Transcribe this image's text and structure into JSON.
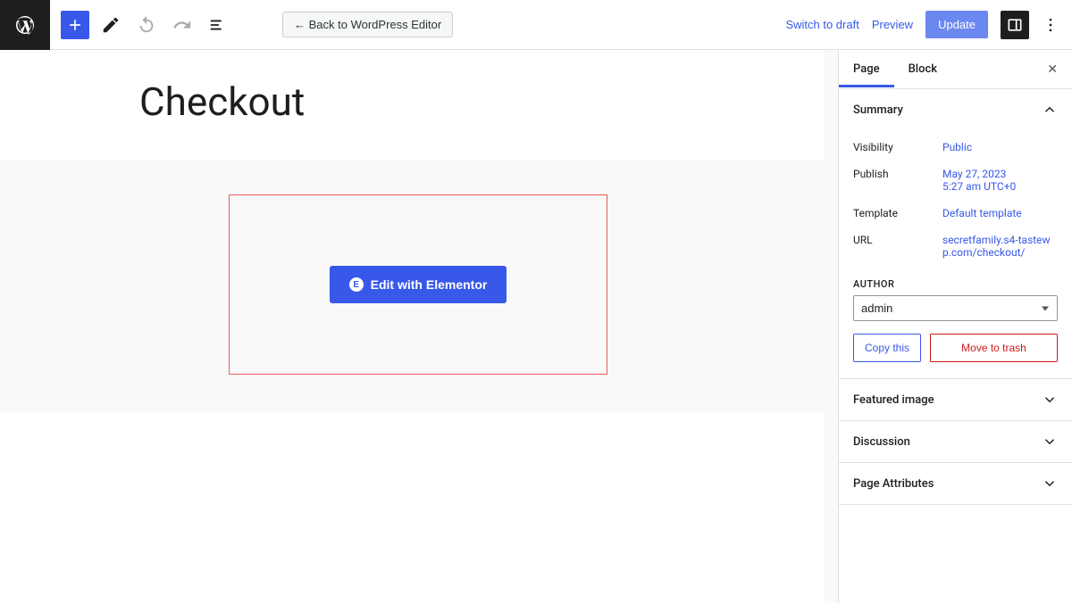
{
  "toolbar": {
    "back_label": "← Back to WordPress Editor",
    "switch_draft": "Switch to draft",
    "preview": "Preview",
    "update": "Update"
  },
  "editor": {
    "title": "Checkout",
    "elementor_button": "Edit with Elementor"
  },
  "sidebar": {
    "tabs": {
      "page": "Page",
      "block": "Block"
    },
    "summary": {
      "header": "Summary",
      "visibility_label": "Visibility",
      "visibility_value": "Public",
      "publish_label": "Publish",
      "publish_value_line1": "May 27, 2023",
      "publish_value_line2": "5:27 am UTC+0",
      "template_label": "Template",
      "template_value": "Default template",
      "url_label": "URL",
      "url_value": "secretfamily.s4-tastewp.com/checkout/",
      "author_label": "AUTHOR",
      "author_value": "admin",
      "copy_label": "Copy this",
      "trash_label": "Move to trash"
    },
    "panels": {
      "featured": "Featured image",
      "discussion": "Discussion",
      "attributes": "Page Attributes"
    }
  }
}
